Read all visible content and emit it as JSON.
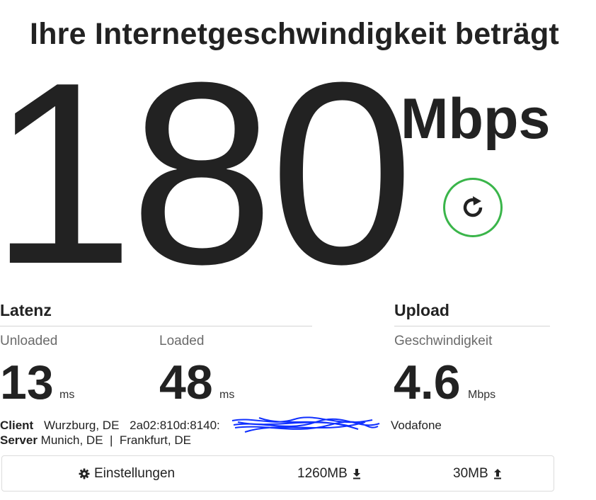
{
  "headline": "Ihre Internetgeschwindigkeit beträgt",
  "download": {
    "value": "180",
    "unit": "Mbps"
  },
  "retry_icon": "refresh-icon",
  "latency": {
    "title": "Latenz",
    "unloaded": {
      "label": "Unloaded",
      "value": "13",
      "unit": "ms"
    },
    "loaded": {
      "label": "Loaded",
      "value": "48",
      "unit": "ms"
    }
  },
  "upload": {
    "title": "Upload",
    "label": "Geschwindigkeit",
    "value": "4.6",
    "unit": "Mbps"
  },
  "client": {
    "label": "Client",
    "location": "Wurzburg, DE",
    "ip": "2a02:810d:8140:",
    "provider": "Vodafone"
  },
  "server": {
    "label": "Server",
    "location1": "Munich, DE",
    "separator": "|",
    "location2": "Frankfurt, DE"
  },
  "settings_bar": {
    "settings_label": "Einstellungen",
    "download_size": "1260MB",
    "upload_size": "30MB"
  },
  "colors": {
    "text": "#222222",
    "muted": "#6b6b6b",
    "accent_green": "#3ab54a",
    "redaction_blue": "#1030ff"
  }
}
